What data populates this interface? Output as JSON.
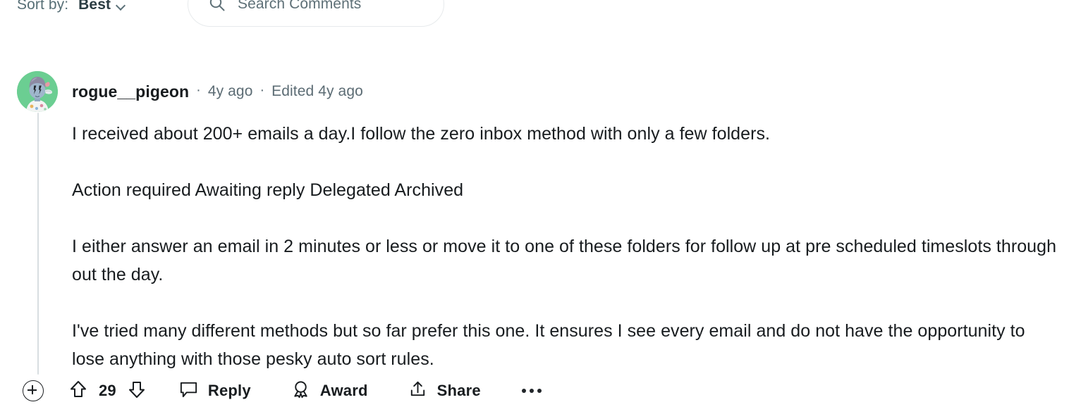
{
  "controls": {
    "sort_label": "Sort by:",
    "sort_value": "Best",
    "sort_chevron_icon": "chevron-down-icon",
    "search_icon": "search-icon",
    "search_placeholder": "Search Comments"
  },
  "comment": {
    "avatar_icon": "avatar-snoo-icon",
    "avatar_bg_color": "#6bce92",
    "author": "rogue__pigeon",
    "dot_separator": "·",
    "timestamp": "4y ago",
    "edited": "Edited 4y ago",
    "paragraphs": [
      "I received about 200+ emails a day.I follow the zero inbox method with only a few folders.",
      "Action required Awaiting reply Delegated Archived",
      "I either answer an email in 2 minutes or less or move it to one of these folders for follow up at pre scheduled timeslots through out the day.",
      "I've tried many different methods but so far prefer this one. It ensures I see every email and do not have the opportunity to lose anything with those pesky auto sort rules."
    ],
    "actions": {
      "collapse_icon": "plus-circle-icon",
      "upvote_icon": "upvote-arrow-icon",
      "vote_count": "29",
      "downvote_icon": "downvote-arrow-icon",
      "reply_icon": "comment-bubble-icon",
      "reply_label": "Reply",
      "award_icon": "award-rosette-icon",
      "award_label": "Award",
      "share_icon": "share-upload-icon",
      "share_label": "Share",
      "more_icon": "more-horizontal-icon"
    }
  },
  "colors": {
    "text_primary": "#181c1f",
    "text_muted": "#5c6c74",
    "thread_line": "#d8dee1",
    "border": "#e7eaec"
  }
}
